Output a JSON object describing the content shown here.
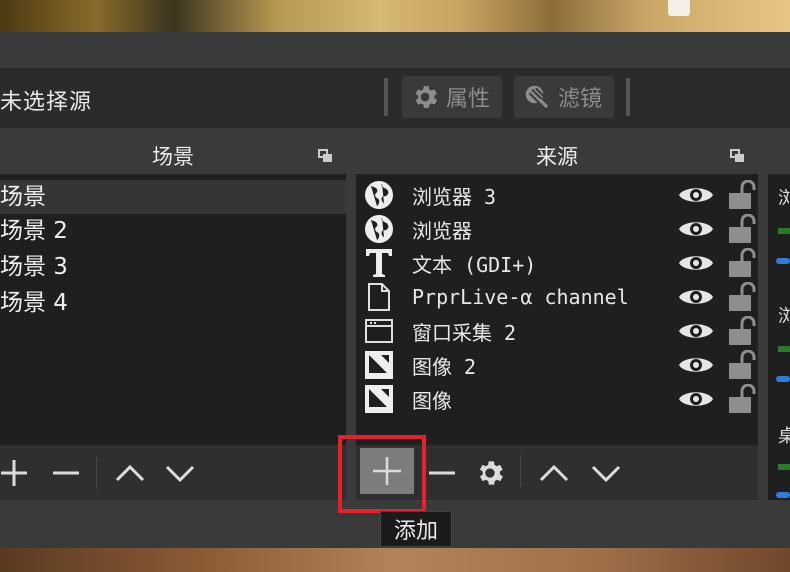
{
  "toolbar": {
    "no_source_label": "未选择源",
    "properties_label": "属性",
    "filters_label": "滤镜"
  },
  "scenes": {
    "header": "场景",
    "items": [
      "场景",
      "场景 2",
      "场景 3",
      "场景 4"
    ]
  },
  "sources": {
    "header": "来源",
    "items": [
      {
        "name": "浏览器 3",
        "icon": "globe-icon"
      },
      {
        "name": "浏览器",
        "icon": "globe-icon"
      },
      {
        "name": "文本 (GDI+)",
        "icon": "text-icon"
      },
      {
        "name": "PrprLive-α channel",
        "icon": "file-icon"
      },
      {
        "name": "窗口采集 2",
        "icon": "window-icon"
      },
      {
        "name": "图像 2",
        "icon": "image-icon"
      },
      {
        "name": "图像",
        "icon": "image-icon"
      }
    ]
  },
  "tooltip": {
    "add_label": "添加"
  },
  "mixer": {
    "names": [
      "浏",
      "浏",
      "桌"
    ]
  },
  "colors": {
    "highlight_red": "#e8202a",
    "panel_bg": "#1f1f1f",
    "header_bg": "#3a3a3a"
  }
}
